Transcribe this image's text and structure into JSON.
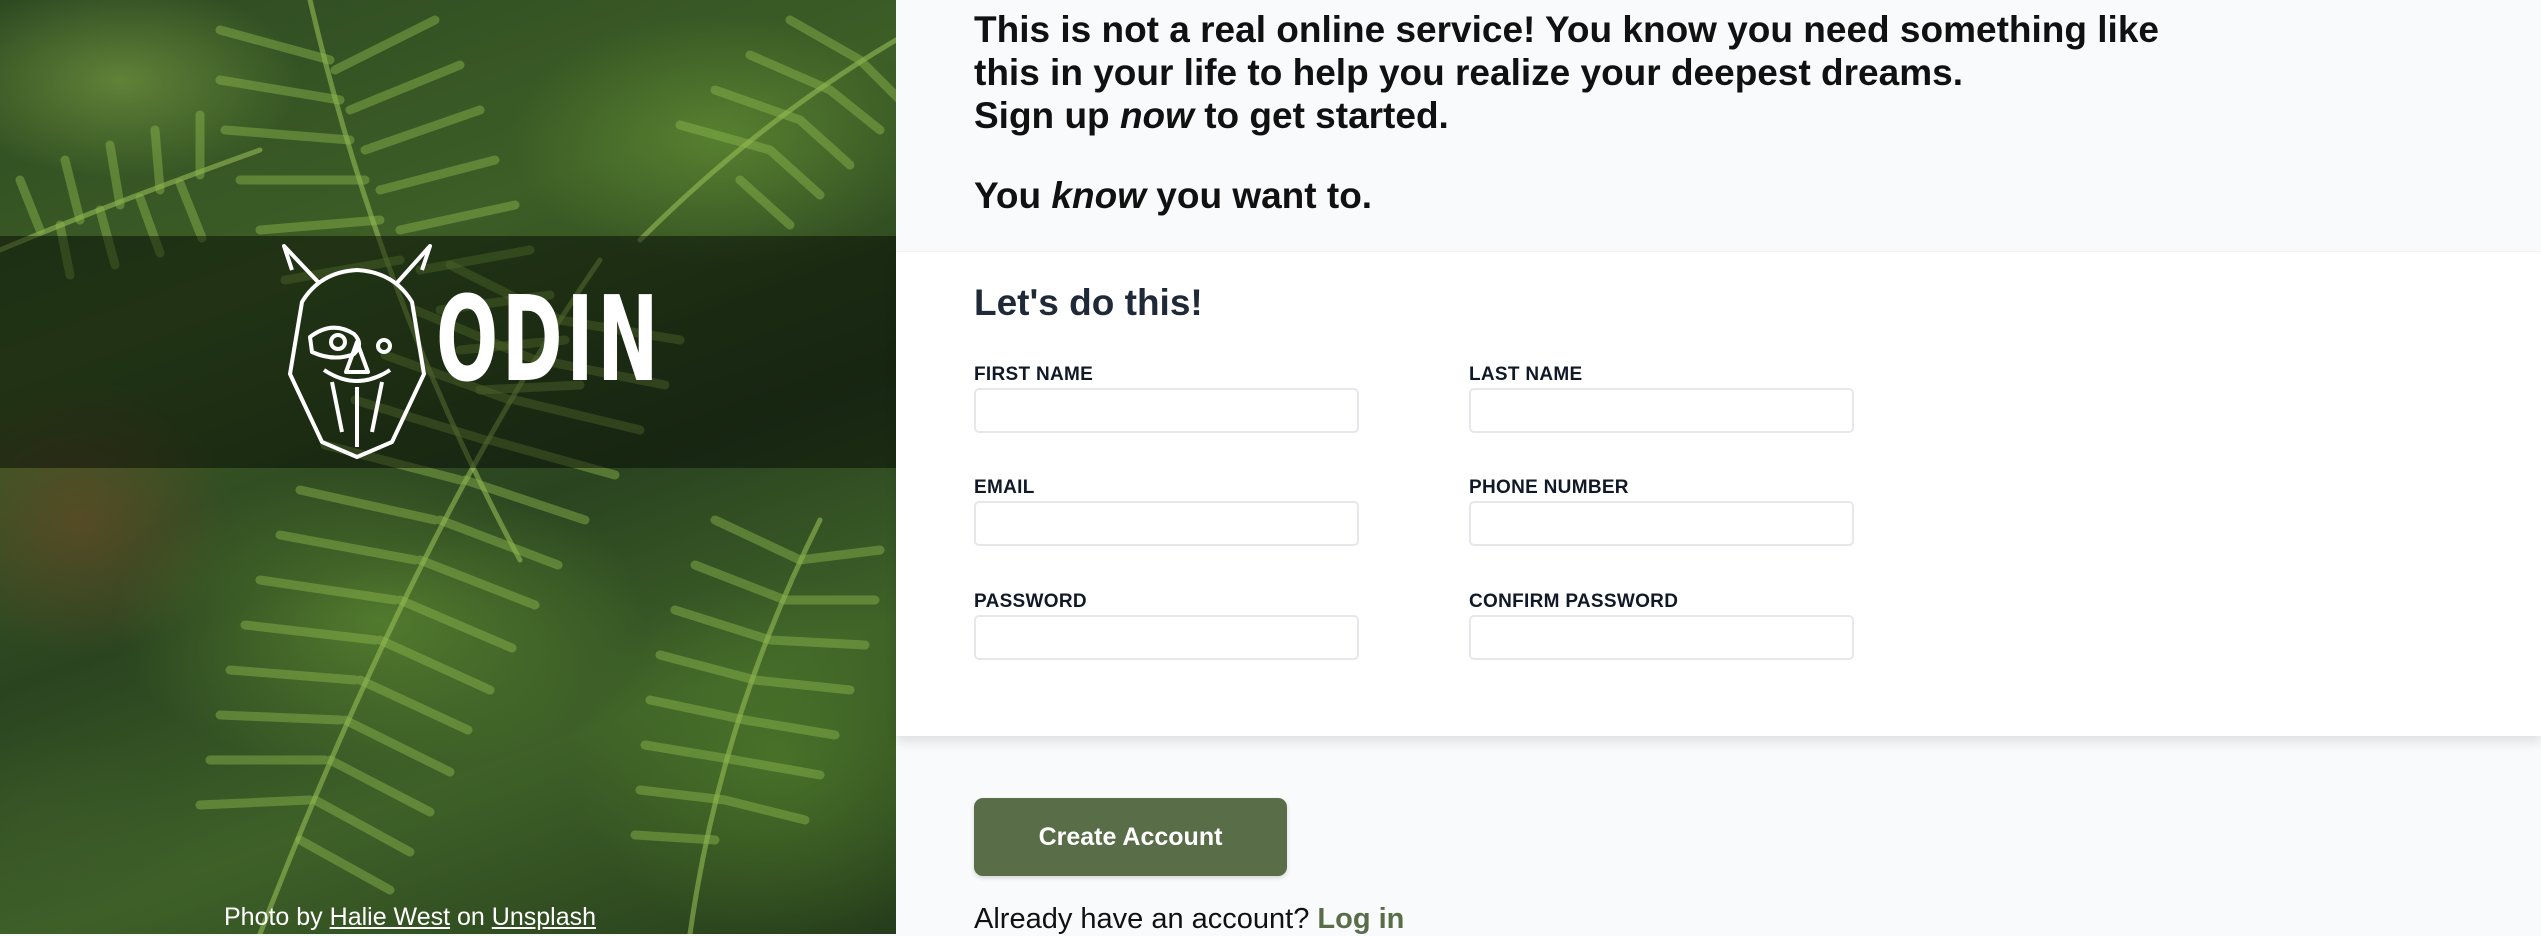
{
  "hero": {
    "logo_text": "ODIN",
    "photo_credit": {
      "prefix": "Photo by",
      "author": "Halie West",
      "middle": "on",
      "source": "Unsplash"
    }
  },
  "intro": {
    "line1": "This is not a real online service! You know you need something like",
    "line2": "this in your life to help you realize your deepest dreams.",
    "line3_before": "Sign up ",
    "line3_em": "now",
    "line3_after": " to get started.",
    "line4_before": "You ",
    "line4_em": "know",
    "line4_after": " you want to."
  },
  "form": {
    "title": "Let's do this!",
    "fields": [
      {
        "label": "FIRST NAME",
        "value": ""
      },
      {
        "label": "LAST NAME",
        "value": ""
      },
      {
        "label": "EMAIL",
        "value": ""
      },
      {
        "label": "PHONE NUMBER",
        "value": ""
      },
      {
        "label": "PASSWORD",
        "value": ""
      },
      {
        "label": "CONFIRM PASSWORD",
        "value": ""
      }
    ]
  },
  "actions": {
    "create_label": "Create Account",
    "login_prompt": "Already have an account?",
    "login_link": "Log in"
  },
  "colors": {
    "accent": "#596d48",
    "page_background": "#f9fafb",
    "card_background": "#ffffff"
  }
}
